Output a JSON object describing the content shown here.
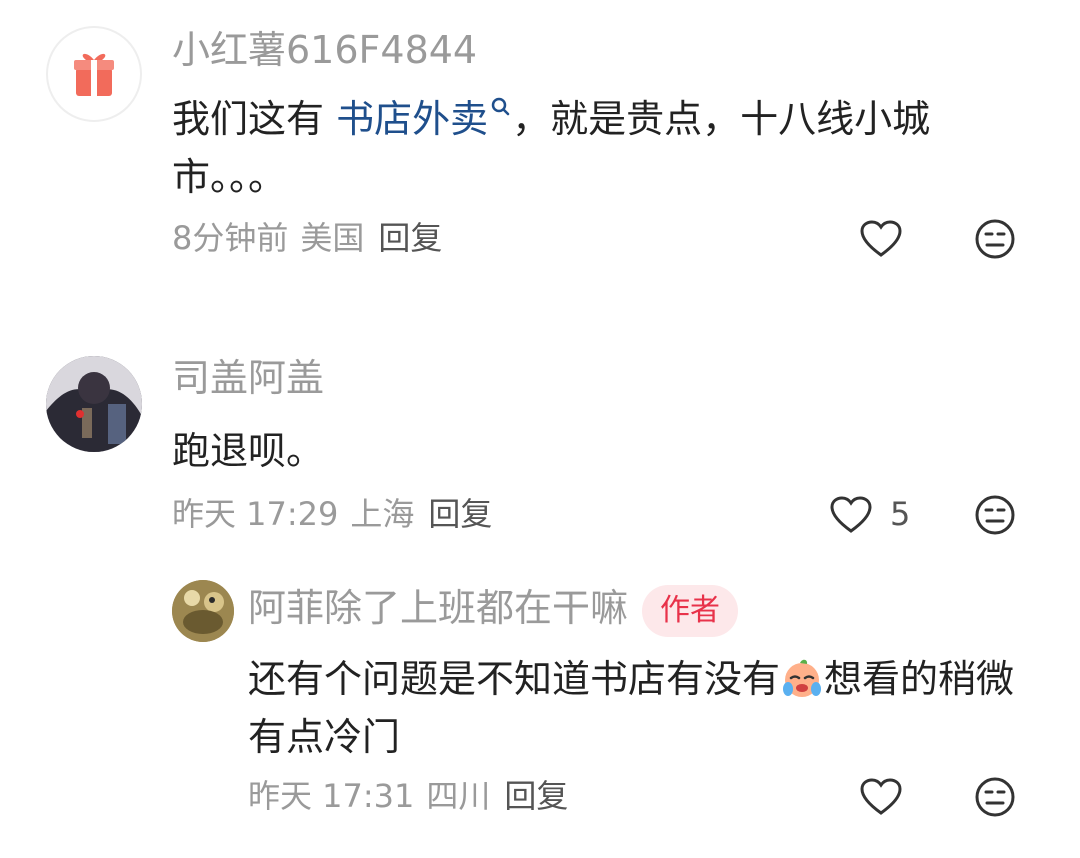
{
  "comments": [
    {
      "name": "小红薯616F4844",
      "text_before": "我们这有 ",
      "link": "书店外卖",
      "text_after": "，就是贵点，十八线小城市。。。",
      "time": "8分钟前",
      "location": "美国",
      "reply_label": "回复",
      "likes": ""
    },
    {
      "name": "司盖阿盖",
      "text": "跑退呗。",
      "time": "昨天 17:29",
      "location": "上海",
      "reply_label": "回复",
      "likes": "5"
    }
  ],
  "reply": {
    "name": "阿菲除了上班都在干嘛",
    "badge": "作者",
    "text_before": "还有个问题是不知道书店有没有",
    "text_after": "想看的稍微有点冷门",
    "time": "昨天 17:31",
    "location": "四川",
    "reply_label": "回复"
  },
  "colors": {
    "name": "#9a9a9a",
    "link": "#1f4f8c",
    "badge_bg": "#fde8ea",
    "badge_text": "#e8324a"
  },
  "icons": [
    "gift-icon",
    "search-icon",
    "heart-icon",
    "neutral-face-icon",
    "crying-emoji"
  ]
}
